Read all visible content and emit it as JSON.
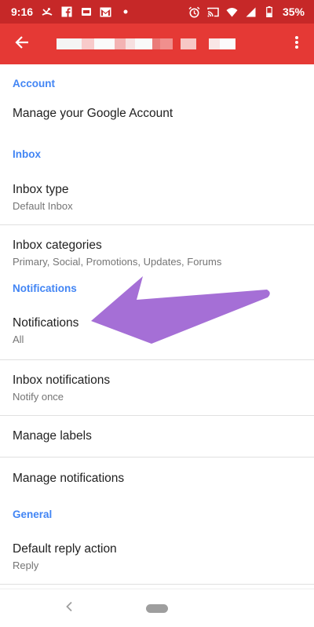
{
  "status_bar": {
    "time": "9:16",
    "battery": "35%",
    "left_icons": [
      "missed-call-icon",
      "facebook-icon",
      "sim-card-icon",
      "gmail-icon",
      "dot-icon"
    ],
    "right_icons": [
      "alarm-icon",
      "cast-icon",
      "wifi-icon",
      "signal-icon",
      "battery-icon"
    ]
  },
  "app_bar": {
    "back_icon": "arrow-back-icon",
    "menu_icon": "more-vert-icon",
    "title_redacted": true
  },
  "sections": {
    "account": {
      "header": "Account",
      "manage_account": "Manage your Google Account"
    },
    "inbox": {
      "header": "Inbox",
      "inbox_type_title": "Inbox type",
      "inbox_type_sub": "Default Inbox",
      "inbox_categories_title": "Inbox categories",
      "inbox_categories_sub": "Primary, Social, Promotions, Updates, Forums"
    },
    "notifications": {
      "header": "Notifications",
      "notifications_title": "Notifications",
      "notifications_sub": "All",
      "inbox_notifications_title": "Inbox notifications",
      "inbox_notifications_sub": "Notify once",
      "manage_labels": "Manage labels",
      "manage_notifications": "Manage notifications"
    },
    "general": {
      "header": "General",
      "default_reply_title": "Default reply action",
      "default_reply_sub": "Reply"
    }
  },
  "colors": {
    "app_bar": "#e53935",
    "status_bar": "#c62828",
    "section_header": "#4285f4",
    "annotation_arrow": "#a56fd6"
  }
}
